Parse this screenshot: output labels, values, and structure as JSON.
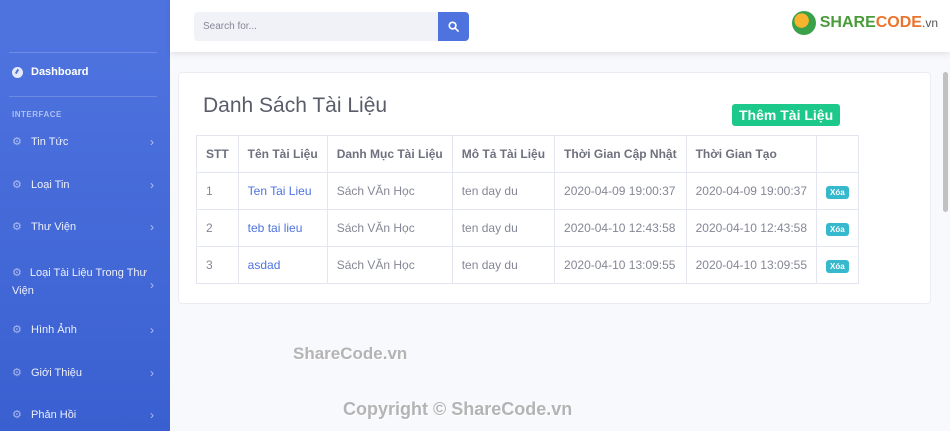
{
  "sidebar": {
    "dashboard_label": "Dashboard",
    "heading": "INTERFACE",
    "items": [
      {
        "label": "Tin Tức"
      },
      {
        "label": "Loại Tin"
      },
      {
        "label": "Thư Viện"
      },
      {
        "label": "Loại Tài Liệu Trong Thư Viện"
      },
      {
        "label": "Hình Ảnh"
      },
      {
        "label": "Giới Thiệu"
      },
      {
        "label": "Phản Hồi"
      }
    ]
  },
  "topbar": {
    "search_placeholder": "Search for...",
    "logo_share": "SHARE",
    "logo_code": "CODE",
    "logo_vn": ".vn"
  },
  "main": {
    "title": "Danh Sách Tài Liệu",
    "add_button": "Thêm Tài Liệu",
    "table": {
      "headers": [
        "STT",
        "Tên Tài Liệu",
        "Danh Mục Tài Liệu",
        "Mô Tả Tài Liệu",
        "Thời Gian Cập Nhật",
        "Thời Gian Tạo",
        ""
      ],
      "rows": [
        [
          "1",
          "Ten Tai Lieu",
          "Sách VĂn Học",
          "ten day du",
          "2020-04-09 19:00:37",
          "2020-04-09 19:00:37",
          "Xóa"
        ],
        [
          "2",
          "teb tai lieu",
          "Sách VĂn Học",
          "ten day du",
          "2020-04-10 12:43:58",
          "2020-04-10 12:43:58",
          "Xóa"
        ],
        [
          "3",
          "asdad",
          "Sách VĂn Học",
          "ten day du",
          "2020-04-10 13:09:55",
          "2020-04-10 13:09:55",
          "Xóa"
        ]
      ]
    }
  },
  "watermark": {
    "line1": "ShareCode.vn",
    "line2": "Copyright © ShareCode.vn"
  },
  "colors": {
    "sidebar": "#4e73df",
    "add_button": "#1cc88a",
    "delete_badge": "#36b9cc",
    "link": "#4e73df"
  }
}
